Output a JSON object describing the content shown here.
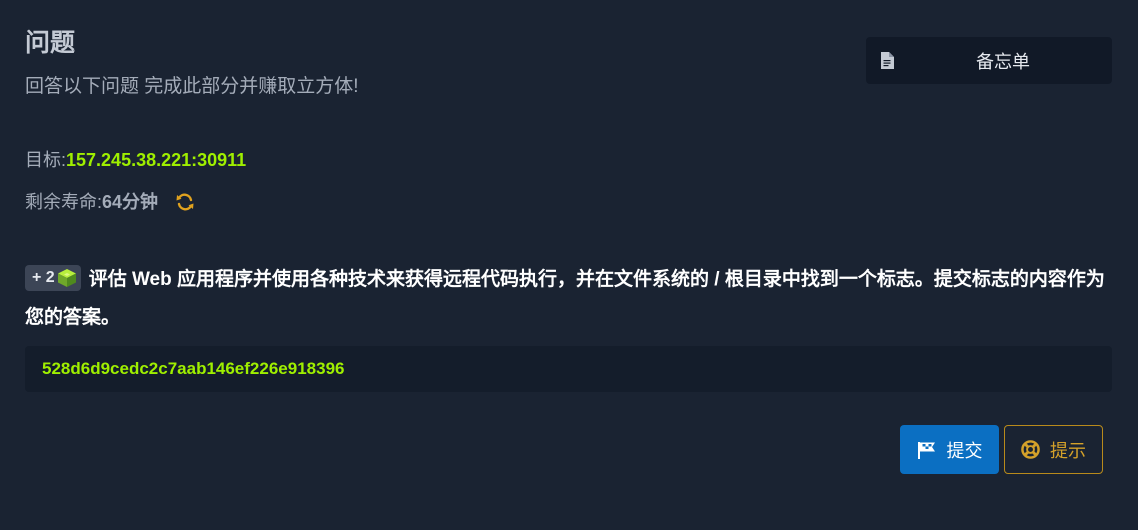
{
  "header": {
    "title": "问题",
    "subtitle": "回答以下问题 完成此部分并赚取立方体!"
  },
  "cheatsheet": {
    "label": "备忘单",
    "icon": "document-icon"
  },
  "target": {
    "label": "目标:",
    "value": "157.245.38.221:30911"
  },
  "life": {
    "label": "剩余寿命:",
    "value": "64分钟",
    "icon": "refresh-icon"
  },
  "question": {
    "badge": "+ 2",
    "badge_icon": "cube-icon",
    "text": "评估 Web 应用程序并使用各种技术来获得远程代码执行，并在文件系统的 / 根目录中找到一个标志。提交标志的内容作为您的答案。"
  },
  "answer": {
    "value": "528d6d9cedc2c7aab146ef226e918396"
  },
  "actions": {
    "submit_label": "提交",
    "submit_icon": "flag-icon",
    "hint_label": "提示",
    "hint_icon": "lifebuoy-icon"
  },
  "colors": {
    "background": "#1a2332",
    "accent_green": "#9fef00",
    "submit_blue": "#0b6fc2",
    "hint_gold": "#d4a12a"
  }
}
